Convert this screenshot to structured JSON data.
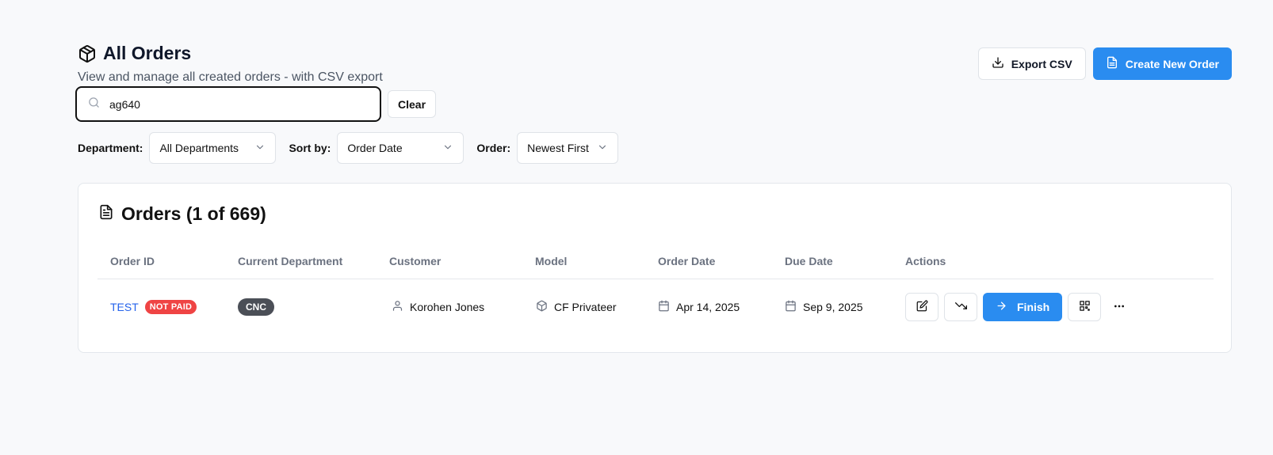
{
  "header": {
    "title": "All Orders",
    "subtitle": "View and manage all created orders - with CSV export",
    "export_label": "Export CSV",
    "create_label": "Create New Order"
  },
  "search": {
    "value": "ag640",
    "placeholder": "",
    "clear_label": "Clear"
  },
  "filters": {
    "department_label": "Department:",
    "department_value": "All Departments",
    "sort_label": "Sort by:",
    "sort_value": "Order Date",
    "order_label": "Order:",
    "order_value": "Newest First"
  },
  "orders_card": {
    "title": "Orders (1 of 669)",
    "columns": [
      "Order ID",
      "Current Department",
      "Customer",
      "Model",
      "Order Date",
      "Due Date",
      "Actions"
    ],
    "rows": [
      {
        "order_id": "TEST",
        "payment_badge": "NOT PAID",
        "department": "CNC",
        "customer": "Korohen Jones",
        "model": "CF Privateer",
        "order_date": "Apr 14, 2025",
        "due_date": "Sep 9, 2025",
        "finish_label": "Finish",
        "more_label": "···"
      }
    ]
  },
  "colors": {
    "primary": "#2a8cf0",
    "danger": "#ef4444",
    "link": "#2563eb",
    "dept_badge": "#4b4f57"
  },
  "icons": [
    "package-icon",
    "download-icon",
    "file-text-icon",
    "search-icon",
    "chevron-down-icon",
    "user-icon",
    "box-icon",
    "calendar-icon",
    "edit-icon",
    "trending-down-icon",
    "arrow-right-icon",
    "qr-code-icon",
    "more-horizontal-icon"
  ]
}
